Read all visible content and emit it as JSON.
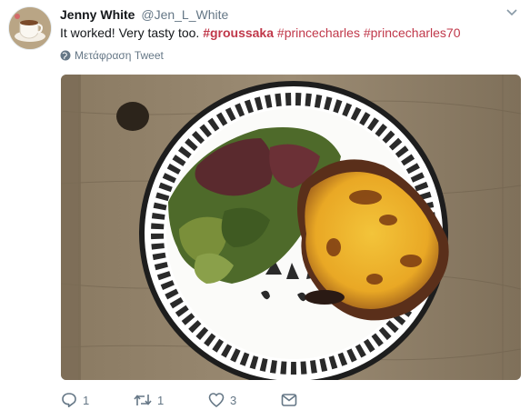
{
  "tweet": {
    "author_name": "Jenny White",
    "author_handle": "@Jen_L_White",
    "text_prefix": "It worked! Very tasty too. ",
    "hashtags": [
      "#groussaka",
      "#princecharles",
      "#princecharles70"
    ],
    "translate_label": "Μετάφραση Tweet",
    "reply_count": "1",
    "retweet_count": "1",
    "like_count": "3"
  },
  "colors": {
    "hashtag": "#c0384a",
    "muted": "#657786",
    "text": "#14171a"
  },
  "icons": [
    "caret-down-icon",
    "globe-icon",
    "reply-icon",
    "retweet-icon",
    "like-icon",
    "message-icon"
  ]
}
